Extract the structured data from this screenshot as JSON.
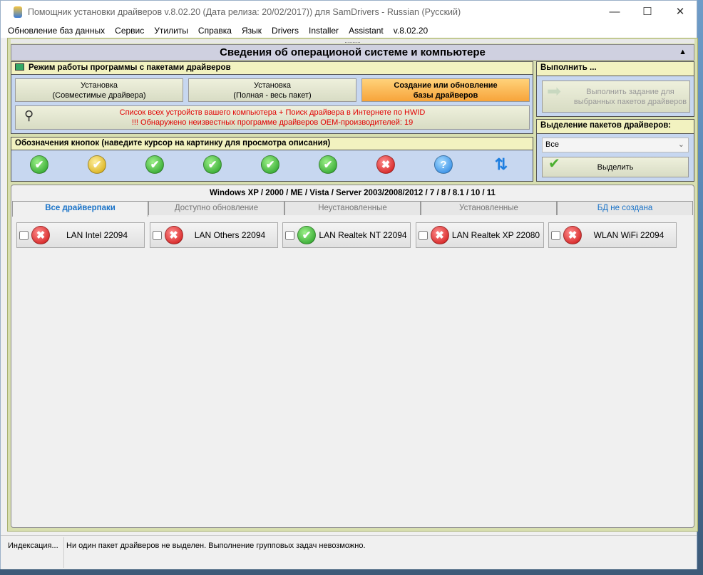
{
  "window": {
    "title": "Помощник установки драйверов v.8.02.20 (Дата релиза: 20/02/2017)) для SamDrivers - Russian (Русский)",
    "minimize": "—",
    "maximize": "☐",
    "close": "✕"
  },
  "menu": [
    "Обновление баз данных",
    "Сервис",
    "Утилиты",
    "Справка",
    "Язык",
    "Drivers",
    "Installer",
    "Assistant",
    "v.8.02.20"
  ],
  "splitter": "..........",
  "header": {
    "title": "Сведения об операционой системе и компьютере",
    "collapse": "▲"
  },
  "mode": {
    "title": "Режим работы программы с пакетами драйверов",
    "buttons": [
      {
        "line1": "Установка",
        "line2": "(Совместимые драйвера)"
      },
      {
        "line1": "Установка",
        "line2": "(Полная - весь пакет)"
      },
      {
        "line1": "Создание или обновление",
        "line2": "базы драйверов"
      }
    ],
    "hwid_line1": "Список всех устройств вашего компьютера + Поиск драйвера в Интернете по HWID",
    "hwid_line2": "!!! Обнаружено неизвестных программе драйверов OEM-производителей: 19"
  },
  "legend": {
    "title": "Обозначения кнопок (наведите курсор на картинку для просмотра описания)",
    "icons": [
      {
        "name": "installed-ok",
        "glyph": "✔"
      },
      {
        "name": "warning",
        "glyph": "✔"
      },
      {
        "name": "update-available",
        "glyph": "✔"
      },
      {
        "name": "hint",
        "glyph": "✔"
      },
      {
        "name": "update-warning",
        "glyph": "✔"
      },
      {
        "name": "hint-warning",
        "glyph": "✔"
      },
      {
        "name": "not-installed",
        "glyph": "✖"
      },
      {
        "name": "unknown",
        "glyph": "?"
      },
      {
        "name": "refresh",
        "glyph": "⇅"
      }
    ]
  },
  "execute": {
    "title": "Выполнить ...",
    "button": "Выполнить задание для выбранных пакетов драйверов"
  },
  "selection": {
    "title": "Выделение пакетов драйверов:",
    "value": "Все",
    "button": "Выделить"
  },
  "os_line": "Windows XP / 2000 / ME / Vista / Server 2003/2008/2012 / 7 / 8 / 8.1 / 10 / 11",
  "tabs": [
    "Все драйверпаки",
    "Доступно обновление",
    "Неустановленные",
    "Установленные",
    "БД не создана"
  ],
  "packs": [
    {
      "label": "LAN Intel 22094",
      "status": "error"
    },
    {
      "label": "LAN Others 22094",
      "status": "error"
    },
    {
      "label": "LAN Realtek NT 22094",
      "status": "update"
    },
    {
      "label": "LAN Realtek XP 22080",
      "status": "error"
    },
    {
      "label": "WLAN WiFi 22094",
      "status": "error"
    }
  ],
  "status": {
    "left": "Индексация...",
    "message": "Ни один пакет драйверов не выделен. Выполнение групповых задач невозможно."
  }
}
